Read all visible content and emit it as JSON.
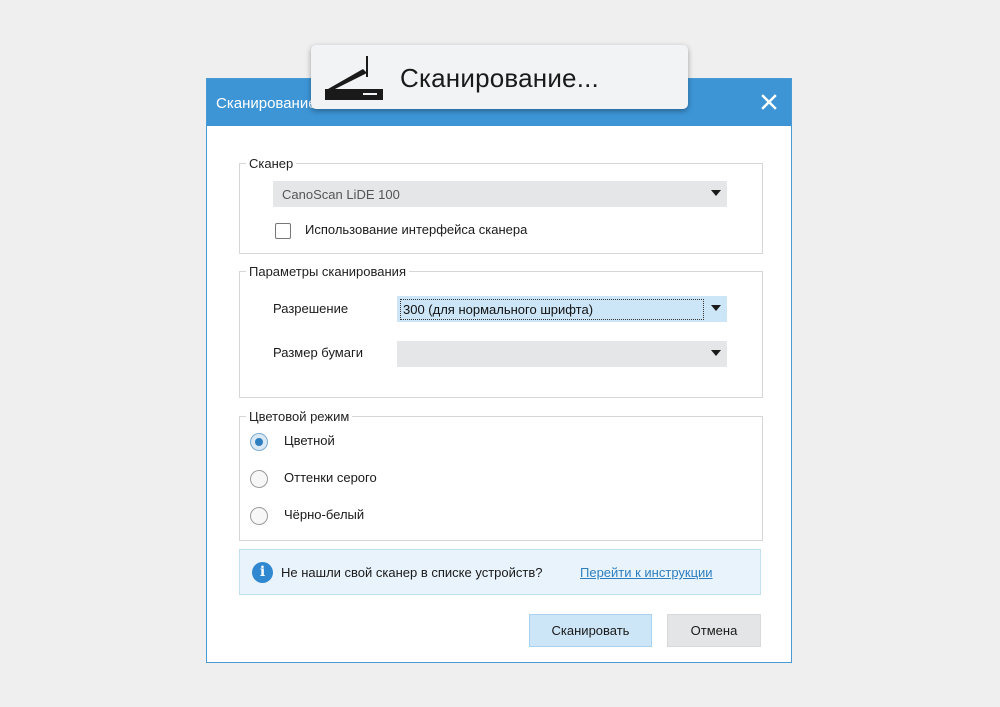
{
  "dialog": {
    "title": "Сканирование",
    "close_icon": "close-icon"
  },
  "scanner_group": {
    "legend": "Сканер",
    "device": "CanoScan LiDE 100",
    "use_interface_label": "Использование интерфейса сканера",
    "use_interface_checked": false
  },
  "params_group": {
    "legend": "Параметры сканирования",
    "resolution_label": "Разрешение",
    "resolution_value": "300 (для нормального шрифта)",
    "paper_label": "Размер бумаги",
    "paper_value": ""
  },
  "color_group": {
    "legend": "Цветовой режим",
    "options": [
      "Цветной",
      "Оттенки серого",
      "Чёрно-белый"
    ],
    "selected": "Цветной"
  },
  "info": {
    "icon": "info-icon",
    "text": "Не нашли свой сканер в списке устройств?",
    "link": "Перейти к инструкции"
  },
  "buttons": {
    "scan": "Сканировать",
    "cancel": "Отмена"
  },
  "toast": {
    "icon": "scanner-icon",
    "message": "Сканирование..."
  },
  "colors": {
    "titlebar": "#3d95d6",
    "primary_button": "#cde6f7",
    "link": "#2f7fc0"
  }
}
